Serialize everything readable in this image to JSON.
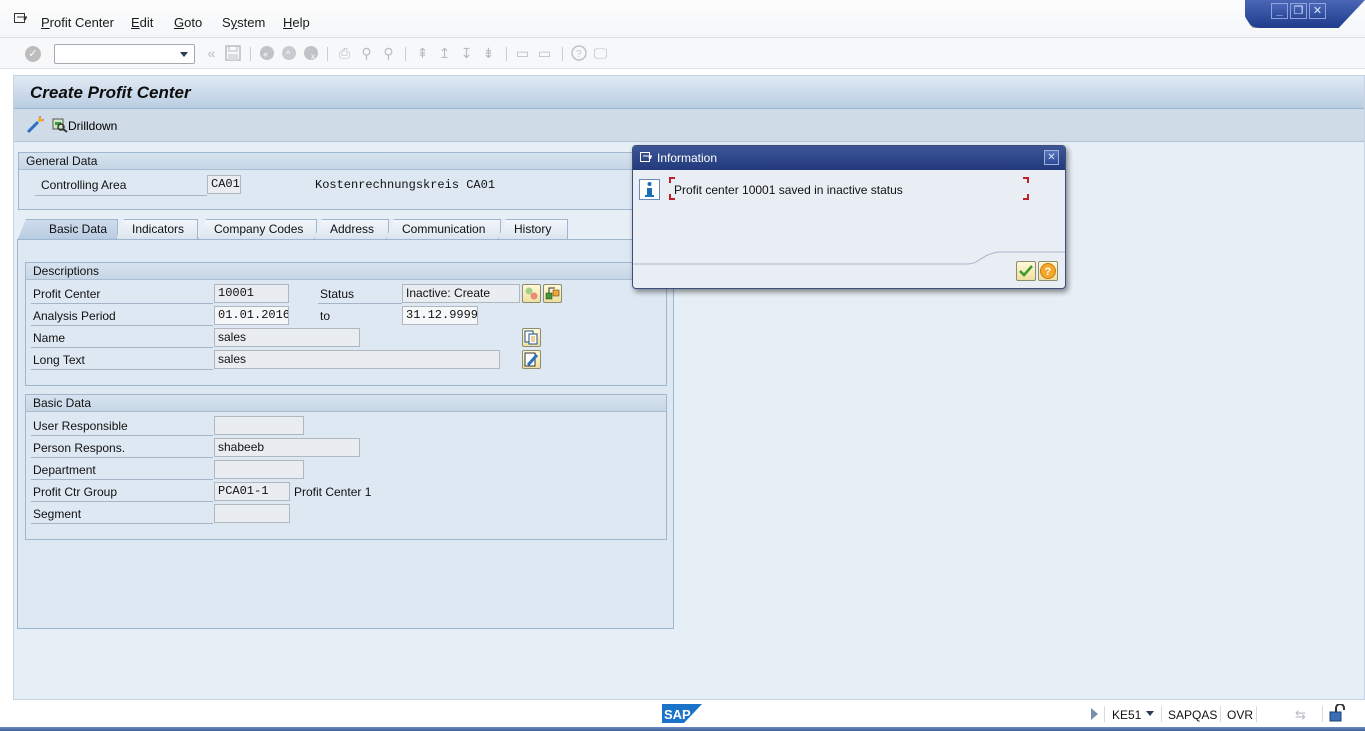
{
  "menubar": {
    "items": [
      {
        "label": "Profit Center",
        "mnemonic": "P"
      },
      {
        "label": "Edit",
        "mnemonic": "E"
      },
      {
        "label": "Goto",
        "mnemonic": "G"
      },
      {
        "label": "System",
        "mnemonic": "y"
      },
      {
        "label": "Help",
        "mnemonic": "H"
      }
    ],
    "window_controls": [
      "minimize",
      "restore",
      "close"
    ]
  },
  "toolbar": {
    "command_field": {
      "value": "",
      "placeholder": ""
    },
    "icons": [
      "enter-icon",
      "back-icon",
      "save-icon",
      "back-nav-icon",
      "exit-icon",
      "cancel-icon",
      "print-icon",
      "find-icon",
      "find-next-icon",
      "first-page-icon",
      "previous-page-icon",
      "next-page-icon",
      "last-page-icon",
      "create-session-icon",
      "shortcut-icon",
      "help-icon",
      "customize-layout-icon"
    ]
  },
  "screen": {
    "title": "Create Profit Center",
    "app_toolbar": {
      "drilldown_label": "Drilldown"
    }
  },
  "general_data": {
    "header": "General Data",
    "controlling_area_label": "Controlling Area",
    "controlling_area_value": "CA01",
    "controlling_area_text": "Kostenrechnungskreis CA01"
  },
  "tabs": [
    {
      "label": "Basic Data",
      "active": true
    },
    {
      "label": "Indicators",
      "active": false
    },
    {
      "label": "Company Codes",
      "active": false
    },
    {
      "label": "Address",
      "active": false
    },
    {
      "label": "Communication",
      "active": false
    },
    {
      "label": "History",
      "active": false
    }
  ],
  "descriptions": {
    "header": "Descriptions",
    "profit_center_label": "Profit Center",
    "profit_center_value": "10001",
    "status_label": "Status",
    "status_value": "Inactive: Create",
    "analysis_period_label": "Analysis Period",
    "analysis_from": "01.01.2016",
    "to_label": "to",
    "analysis_to": "31.12.9999",
    "name_label": "Name",
    "name_value": "sales",
    "long_text_label": "Long Text",
    "long_text_value": "sales"
  },
  "basic_data": {
    "header": "Basic Data",
    "user_responsible_label": "User Responsible",
    "user_responsible_value": "",
    "person_respons_label": "Person Respons.",
    "person_respons_value": "shabeeb",
    "department_label": "Department",
    "department_value": "",
    "profit_ctr_group_label": "Profit Ctr Group",
    "profit_ctr_group_value": "PCA01-1",
    "profit_ctr_group_text": "Profit Center 1",
    "segment_label": "Segment",
    "segment_value": ""
  },
  "dialog": {
    "title": "Information",
    "message": "Profit center 10001 saved in inactive status",
    "buttons": [
      "continue",
      "help"
    ]
  },
  "statusbar": {
    "transaction": "KE51",
    "system": "SAPQAS",
    "mode": "OVR",
    "logo": "SAP"
  },
  "colors": {
    "accent_blue": "#223a7b",
    "panel_bg": "#dde8f3",
    "error_bracket": "#c0202a"
  }
}
